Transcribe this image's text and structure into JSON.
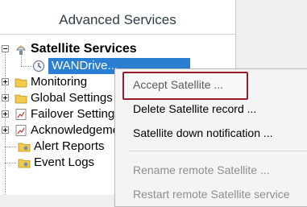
{
  "panel": {
    "title": "Advanced Services"
  },
  "tree": {
    "root_label": "Satellite Services",
    "child_label": "WANDrive...",
    "items": [
      {
        "label": "Monitoring"
      },
      {
        "label": "Global Settings"
      },
      {
        "label": "Failover Settings"
      },
      {
        "label": "Acknowledgement"
      },
      {
        "label": "Alert Reports"
      },
      {
        "label": "Event Logs"
      }
    ]
  },
  "context_menu": {
    "items": [
      {
        "label": "Accept Satellite ...",
        "enabled": true
      },
      {
        "label": "Delete Satellite record ...",
        "enabled": true
      },
      {
        "label": "Satellite down notification ...",
        "enabled": true
      },
      {
        "label": "Rename remote Satellite ...",
        "enabled": false
      },
      {
        "label": "Restart remote Satellite service",
        "enabled": false
      }
    ]
  },
  "colors": {
    "selection": "#2a7fd3",
    "highlight_border": "#9c1b2a",
    "disabled_text": "#8f8f8f"
  }
}
